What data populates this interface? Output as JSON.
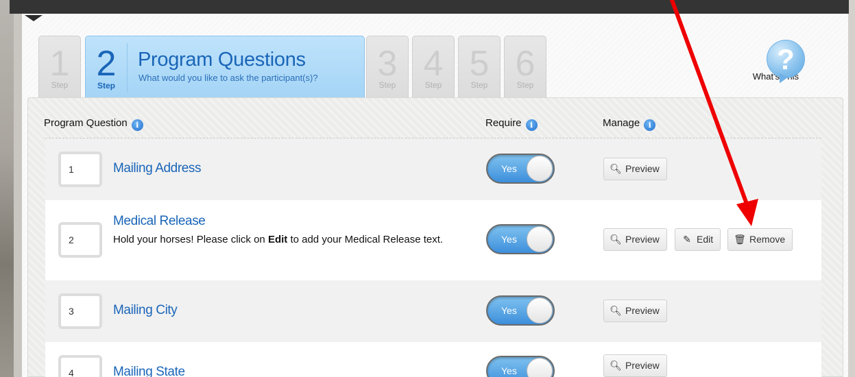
{
  "steps": [
    {
      "number": "1",
      "label": "Step"
    },
    {
      "number": "2",
      "label": "Step",
      "title": "Program Questions",
      "subtitle": "What would you like to ask the participant(s)?"
    },
    {
      "number": "3",
      "label": "Step"
    },
    {
      "number": "4",
      "label": "Step"
    },
    {
      "number": "5",
      "label": "Step"
    },
    {
      "number": "6",
      "label": "Step"
    }
  ],
  "help": {
    "label": "What's This",
    "glyph": "?"
  },
  "columns": {
    "question": "Program Question",
    "require": "Require",
    "manage": "Manage",
    "info_glyph": "i"
  },
  "questions": [
    {
      "number": "1",
      "title": "Mailing Address",
      "require": "Yes",
      "actions": [
        "Preview"
      ]
    },
    {
      "number": "2",
      "title": "Medical Release",
      "desc_before": "Hold your horses! Please click on ",
      "desc_bold": "Edit",
      "desc_after": " to add your Medical Release text.",
      "require": "Yes",
      "actions": [
        "Preview",
        "Edit",
        "Remove"
      ]
    },
    {
      "number": "3",
      "title": "Mailing City",
      "require": "Yes",
      "actions": [
        "Preview"
      ]
    },
    {
      "number": "4",
      "title": "Mailing State",
      "require": "Yes",
      "actions": [
        "Preview"
      ]
    }
  ],
  "icons": {
    "preview": "search-icon",
    "edit": "pencil-icon",
    "remove": "trash-icon"
  },
  "colors": {
    "accent": "#1a65b8",
    "active_tab": "#a4d4f6",
    "annotation": "#ff0000"
  }
}
